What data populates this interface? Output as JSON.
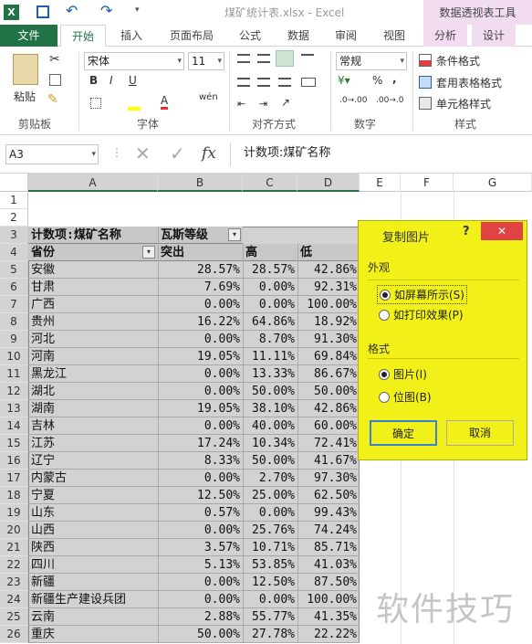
{
  "titlebar": {
    "file_name": "煤矿统计表.xlsx - Excel",
    "context_tab": "数据透视表工具"
  },
  "tabs": [
    "文件",
    "开始",
    "插入",
    "页面布局",
    "公式",
    "数据",
    "审阅",
    "视图",
    "分析",
    "设计"
  ],
  "ribbon": {
    "paste_label": "粘贴",
    "clipboard_label": "剪贴板",
    "font_name": "宋体",
    "font_size": "11",
    "font_label": "字体",
    "align_label": "对齐方式",
    "number_format": "常规",
    "number_label": "数字",
    "cond_format": "条件格式",
    "table_format": "套用表格格式",
    "cell_style": "单元格样式",
    "style_label": "样式",
    "bold": "B",
    "italic": "I",
    "underline": "U",
    "font_color_letter": "A",
    "wen": "wén",
    "percent": "%",
    "comma": ","
  },
  "formula_bar": {
    "name_box": "A3",
    "fx": "fx",
    "content": "计数项:煤矿名称"
  },
  "columns": [
    "A",
    "B",
    "C",
    "D",
    "E",
    "F",
    "G"
  ],
  "pivot": {
    "header_a3": "计数项:煤矿名称",
    "header_b3": "瓦斯等级",
    "row_label": "省份",
    "col1": "突出",
    "col2": "高",
    "col3": "低",
    "rows": [
      {
        "r": "5",
        "p": "安徽",
        "a": "28.57%",
        "b": "28.57%",
        "c": "42.86%"
      },
      {
        "r": "6",
        "p": "甘肃",
        "a": "7.69%",
        "b": "0.00%",
        "c": "92.31%"
      },
      {
        "r": "7",
        "p": "广西",
        "a": "0.00%",
        "b": "0.00%",
        "c": "100.00%"
      },
      {
        "r": "8",
        "p": "贵州",
        "a": "16.22%",
        "b": "64.86%",
        "c": "18.92%"
      },
      {
        "r": "9",
        "p": "河北",
        "a": "0.00%",
        "b": "8.70%",
        "c": "91.30%"
      },
      {
        "r": "10",
        "p": "河南",
        "a": "19.05%",
        "b": "11.11%",
        "c": "69.84%"
      },
      {
        "r": "11",
        "p": "黑龙江",
        "a": "0.00%",
        "b": "13.33%",
        "c": "86.67%"
      },
      {
        "r": "12",
        "p": "湖北",
        "a": "0.00%",
        "b": "50.00%",
        "c": "50.00%"
      },
      {
        "r": "13",
        "p": "湖南",
        "a": "19.05%",
        "b": "38.10%",
        "c": "42.86%"
      },
      {
        "r": "14",
        "p": "吉林",
        "a": "0.00%",
        "b": "40.00%",
        "c": "60.00%"
      },
      {
        "r": "15",
        "p": "江苏",
        "a": "17.24%",
        "b": "10.34%",
        "c": "72.41%"
      },
      {
        "r": "16",
        "p": "辽宁",
        "a": "8.33%",
        "b": "50.00%",
        "c": "41.67%"
      },
      {
        "r": "17",
        "p": "内蒙古",
        "a": "0.00%",
        "b": "2.70%",
        "c": "97.30%"
      },
      {
        "r": "18",
        "p": "宁夏",
        "a": "12.50%",
        "b": "25.00%",
        "c": "62.50%"
      },
      {
        "r": "19",
        "p": "山东",
        "a": "0.57%",
        "b": "0.00%",
        "c": "99.43%"
      },
      {
        "r": "20",
        "p": "山西",
        "a": "0.00%",
        "b": "25.76%",
        "c": "74.24%"
      },
      {
        "r": "21",
        "p": "陕西",
        "a": "3.57%",
        "b": "10.71%",
        "c": "85.71%"
      },
      {
        "r": "22",
        "p": "四川",
        "a": "5.13%",
        "b": "53.85%",
        "c": "41.03%"
      },
      {
        "r": "23",
        "p": "新疆",
        "a": "0.00%",
        "b": "12.50%",
        "c": "87.50%"
      },
      {
        "r": "24",
        "p": "新疆生产建设兵团",
        "a": "0.00%",
        "b": "0.00%",
        "c": "100.00%"
      },
      {
        "r": "25",
        "p": "云南",
        "a": "2.88%",
        "b": "55.77%",
        "c": "41.35%"
      },
      {
        "r": "26",
        "p": "重庆",
        "a": "50.00%",
        "b": "27.78%",
        "c": "22.22%"
      }
    ]
  },
  "dialog": {
    "title": "复制图片",
    "help": "?",
    "close": "✕",
    "appearance_label": "外观",
    "opt_screen": "如屏幕所示(S)",
    "opt_print": "如打印效果(P)",
    "format_label": "格式",
    "opt_picture": "图片(I)",
    "opt_bitmap": "位图(B)",
    "ok": "确定",
    "cancel": "取消"
  },
  "watermark": "软件技巧",
  "colors": {
    "excel_green": "#217346",
    "dialog_yellow": "#f1f119",
    "close_red": "#e04343",
    "context_tab": "#f2dcf0"
  }
}
